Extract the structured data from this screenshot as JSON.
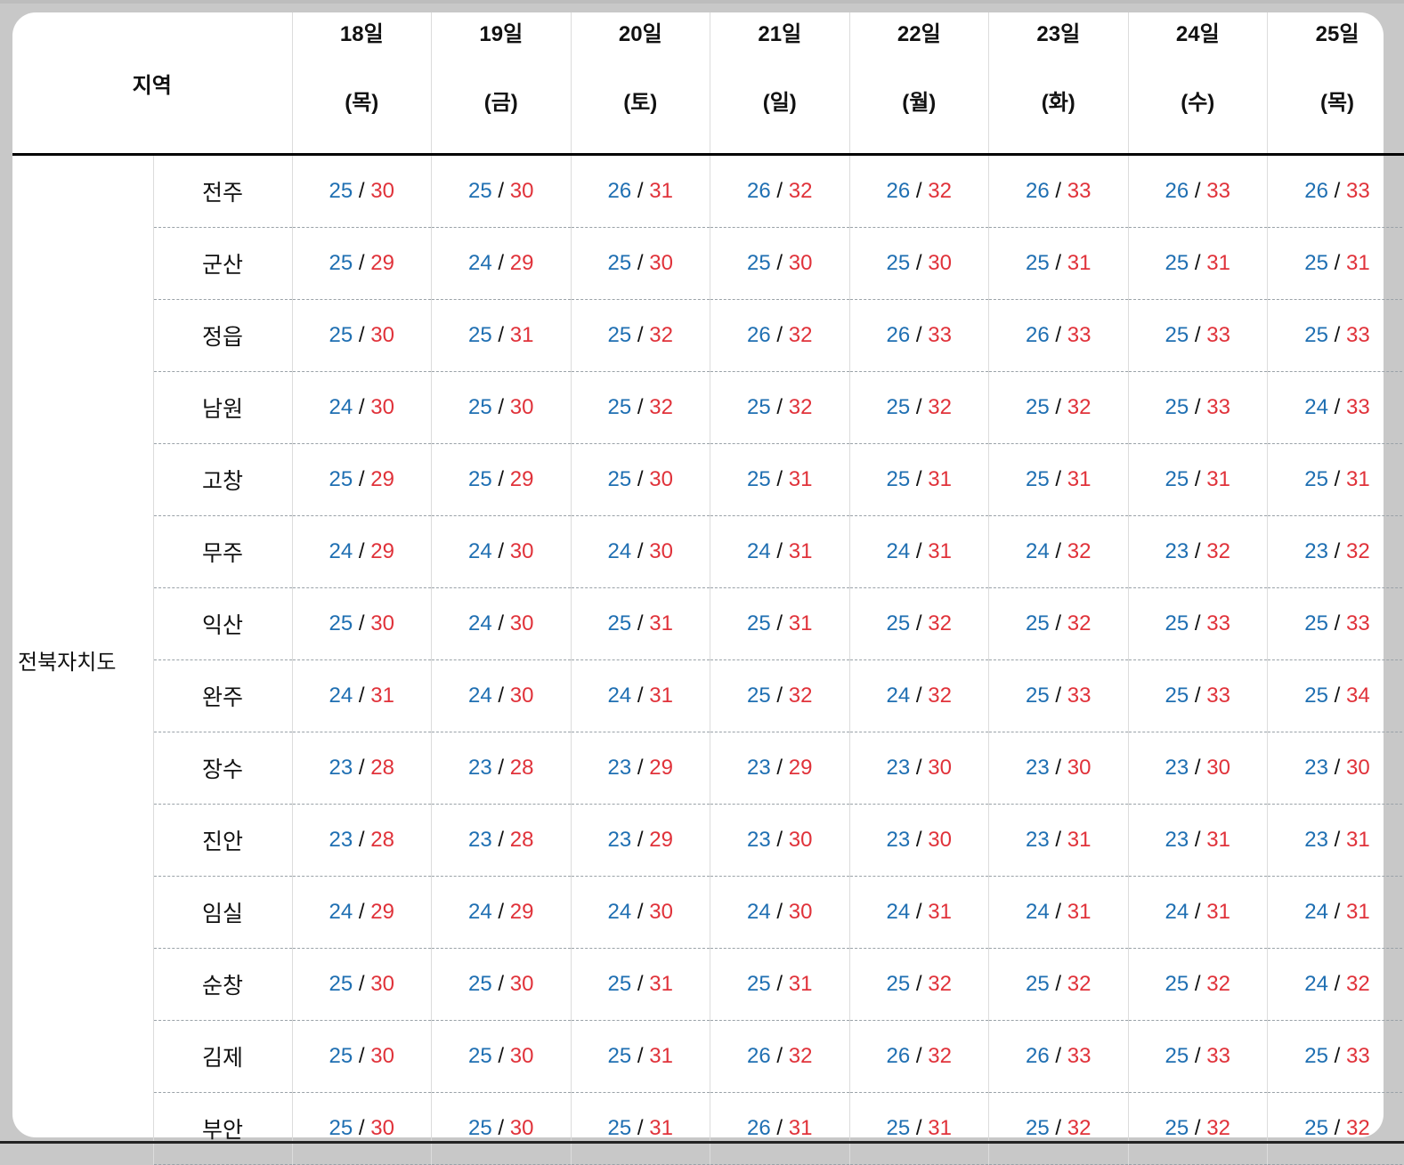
{
  "header": {
    "region_label": "지역",
    "days": [
      {
        "date": "18일",
        "weekday": "(목)"
      },
      {
        "date": "19일",
        "weekday": "(금)"
      },
      {
        "date": "20일",
        "weekday": "(토)"
      },
      {
        "date": "21일",
        "weekday": "(일)"
      },
      {
        "date": "22일",
        "weekday": "(월)"
      },
      {
        "date": "23일",
        "weekday": "(화)"
      },
      {
        "date": "24일",
        "weekday": "(수)"
      },
      {
        "date": "25일",
        "weekday": "(목)"
      }
    ]
  },
  "province": "전북자치도",
  "separator": "/",
  "colors": {
    "low": "#1f6fb2",
    "high": "#e0323a"
  },
  "rows": [
    {
      "city": "전주",
      "temps": [
        [
          "25",
          "30"
        ],
        [
          "25",
          "30"
        ],
        [
          "26",
          "31"
        ],
        [
          "26",
          "32"
        ],
        [
          "26",
          "32"
        ],
        [
          "26",
          "33"
        ],
        [
          "26",
          "33"
        ],
        [
          "26",
          "33"
        ]
      ]
    },
    {
      "city": "군산",
      "temps": [
        [
          "25",
          "29"
        ],
        [
          "24",
          "29"
        ],
        [
          "25",
          "30"
        ],
        [
          "25",
          "30"
        ],
        [
          "25",
          "30"
        ],
        [
          "25",
          "31"
        ],
        [
          "25",
          "31"
        ],
        [
          "25",
          "31"
        ]
      ]
    },
    {
      "city": "정읍",
      "temps": [
        [
          "25",
          "30"
        ],
        [
          "25",
          "31"
        ],
        [
          "25",
          "32"
        ],
        [
          "26",
          "32"
        ],
        [
          "26",
          "33"
        ],
        [
          "26",
          "33"
        ],
        [
          "25",
          "33"
        ],
        [
          "25",
          "33"
        ]
      ]
    },
    {
      "city": "남원",
      "temps": [
        [
          "24",
          "30"
        ],
        [
          "25",
          "30"
        ],
        [
          "25",
          "32"
        ],
        [
          "25",
          "32"
        ],
        [
          "25",
          "32"
        ],
        [
          "25",
          "32"
        ],
        [
          "25",
          "33"
        ],
        [
          "24",
          "33"
        ]
      ]
    },
    {
      "city": "고창",
      "temps": [
        [
          "25",
          "29"
        ],
        [
          "25",
          "29"
        ],
        [
          "25",
          "30"
        ],
        [
          "25",
          "31"
        ],
        [
          "25",
          "31"
        ],
        [
          "25",
          "31"
        ],
        [
          "25",
          "31"
        ],
        [
          "25",
          "31"
        ]
      ]
    },
    {
      "city": "무주",
      "temps": [
        [
          "24",
          "29"
        ],
        [
          "24",
          "30"
        ],
        [
          "24",
          "30"
        ],
        [
          "24",
          "31"
        ],
        [
          "24",
          "31"
        ],
        [
          "24",
          "32"
        ],
        [
          "23",
          "32"
        ],
        [
          "23",
          "32"
        ]
      ]
    },
    {
      "city": "익산",
      "temps": [
        [
          "25",
          "30"
        ],
        [
          "24",
          "30"
        ],
        [
          "25",
          "31"
        ],
        [
          "25",
          "31"
        ],
        [
          "25",
          "32"
        ],
        [
          "25",
          "32"
        ],
        [
          "25",
          "33"
        ],
        [
          "25",
          "33"
        ]
      ]
    },
    {
      "city": "완주",
      "temps": [
        [
          "24",
          "31"
        ],
        [
          "24",
          "30"
        ],
        [
          "24",
          "31"
        ],
        [
          "25",
          "32"
        ],
        [
          "24",
          "32"
        ],
        [
          "25",
          "33"
        ],
        [
          "25",
          "33"
        ],
        [
          "25",
          "34"
        ]
      ]
    },
    {
      "city": "장수",
      "temps": [
        [
          "23",
          "28"
        ],
        [
          "23",
          "28"
        ],
        [
          "23",
          "29"
        ],
        [
          "23",
          "29"
        ],
        [
          "23",
          "30"
        ],
        [
          "23",
          "30"
        ],
        [
          "23",
          "30"
        ],
        [
          "23",
          "30"
        ]
      ]
    },
    {
      "city": "진안",
      "temps": [
        [
          "23",
          "28"
        ],
        [
          "23",
          "28"
        ],
        [
          "23",
          "29"
        ],
        [
          "23",
          "30"
        ],
        [
          "23",
          "30"
        ],
        [
          "23",
          "31"
        ],
        [
          "23",
          "31"
        ],
        [
          "23",
          "31"
        ]
      ]
    },
    {
      "city": "임실",
      "temps": [
        [
          "24",
          "29"
        ],
        [
          "24",
          "29"
        ],
        [
          "24",
          "30"
        ],
        [
          "24",
          "30"
        ],
        [
          "24",
          "31"
        ],
        [
          "24",
          "31"
        ],
        [
          "24",
          "31"
        ],
        [
          "24",
          "31"
        ]
      ]
    },
    {
      "city": "순창",
      "temps": [
        [
          "25",
          "30"
        ],
        [
          "25",
          "30"
        ],
        [
          "25",
          "31"
        ],
        [
          "25",
          "31"
        ],
        [
          "25",
          "32"
        ],
        [
          "25",
          "32"
        ],
        [
          "25",
          "32"
        ],
        [
          "24",
          "32"
        ]
      ]
    },
    {
      "city": "김제",
      "temps": [
        [
          "25",
          "30"
        ],
        [
          "25",
          "30"
        ],
        [
          "25",
          "31"
        ],
        [
          "26",
          "32"
        ],
        [
          "26",
          "32"
        ],
        [
          "26",
          "33"
        ],
        [
          "25",
          "33"
        ],
        [
          "25",
          "33"
        ]
      ]
    },
    {
      "city": "부안",
      "temps": [
        [
          "25",
          "30"
        ],
        [
          "25",
          "30"
        ],
        [
          "25",
          "31"
        ],
        [
          "26",
          "31"
        ],
        [
          "25",
          "31"
        ],
        [
          "25",
          "32"
        ],
        [
          "25",
          "32"
        ],
        [
          "25",
          "32"
        ]
      ]
    }
  ]
}
